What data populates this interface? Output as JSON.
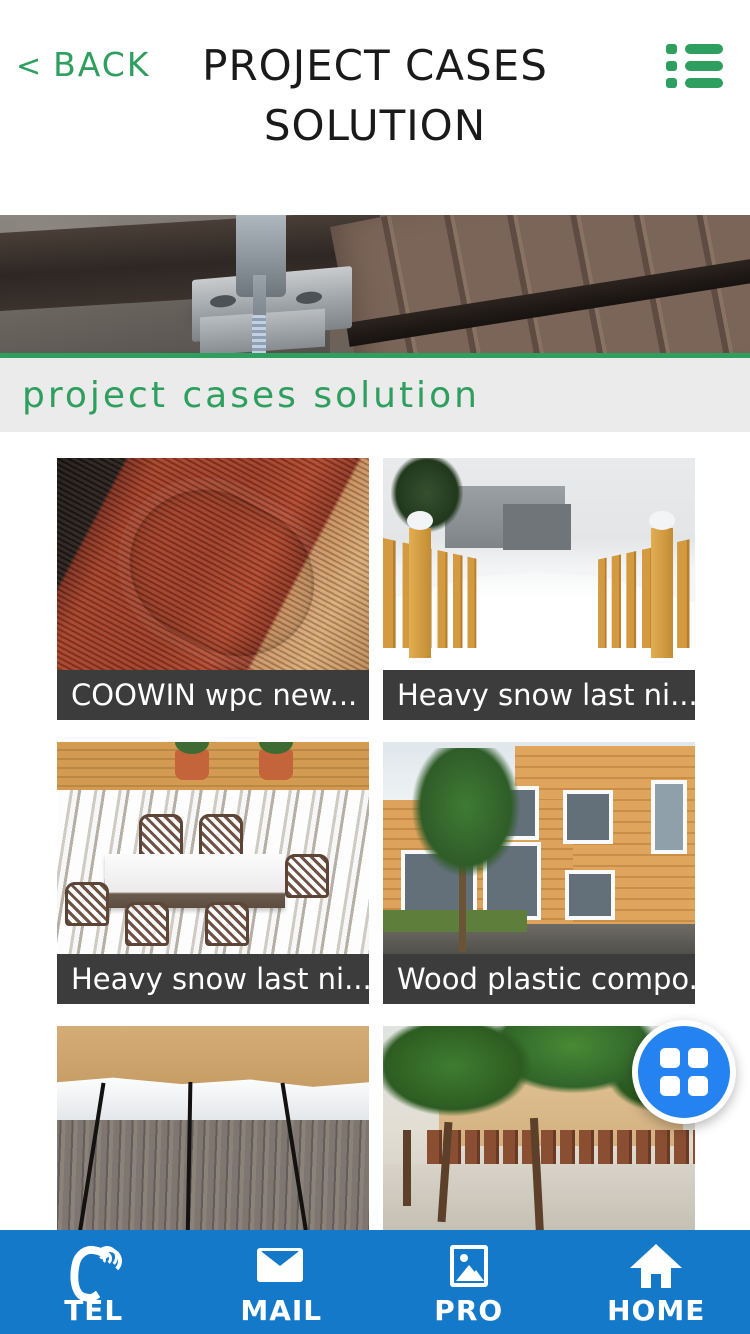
{
  "header": {
    "back_chevron": "<",
    "back_label": "BACK",
    "title": "PROJECT CASES SOLUTION",
    "menu_icon": "list-icon",
    "accent_green": "#2e9f5e"
  },
  "banner": {
    "alt": "wpc decking installation with screw and clip fastener",
    "border_color": "#2e9f5e"
  },
  "section": {
    "title": "project cases solution",
    "background": "#ebebeb",
    "text_color": "#2e9f5e"
  },
  "grid": {
    "cards": [
      {
        "caption": "COOWIN wpc new...",
        "art": "decking"
      },
      {
        "caption": "Heavy snow last ni...",
        "art": "snowfence"
      },
      {
        "caption": "Heavy snow last ni...",
        "art": "patio"
      },
      {
        "caption": "Wood plastic compo...",
        "art": "building"
      },
      {
        "caption": "",
        "art": "snowdeck"
      },
      {
        "caption": "",
        "art": "treefence"
      }
    ]
  },
  "fab": {
    "icon": "grid-squares-icon",
    "color": "#2483f0"
  },
  "bottom_nav": {
    "background": "#1479c8",
    "items": [
      {
        "label": "TEL",
        "icon": "phone-icon"
      },
      {
        "label": "MAIL",
        "icon": "envelope-icon"
      },
      {
        "label": "PRO",
        "icon": "image-icon"
      },
      {
        "label": "HOME",
        "icon": "home-icon"
      }
    ]
  }
}
